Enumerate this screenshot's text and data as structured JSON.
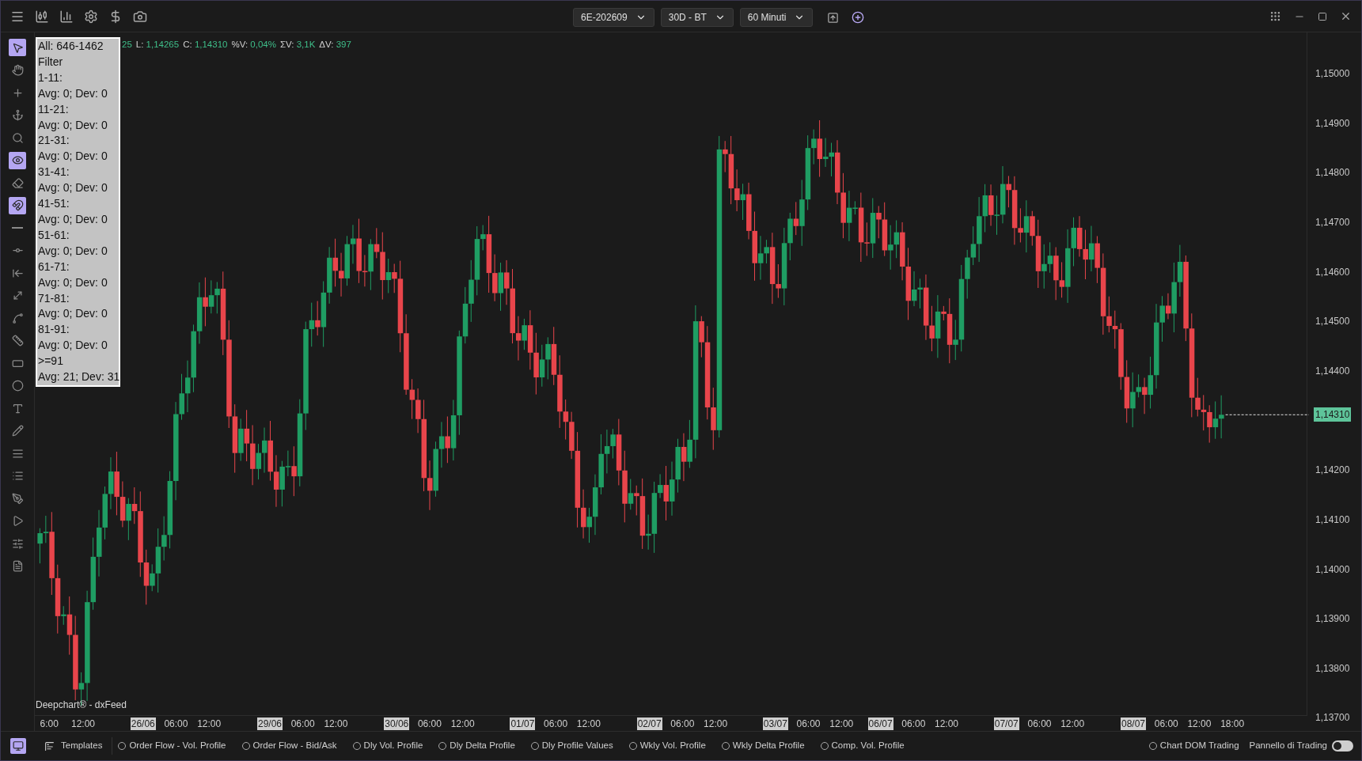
{
  "toolbar": {
    "dropdowns": [
      {
        "label": "6E-202609"
      },
      {
        "label": "30D - BT"
      },
      {
        "label": "60 Minuti"
      }
    ]
  },
  "tools": [
    {
      "selected": true
    },
    {
      "selected": false
    },
    {
      "selected": false
    },
    {
      "selected": false
    },
    {
      "selected": false
    },
    {
      "selected": true
    },
    {
      "selected": false
    },
    {
      "selected": true
    },
    {
      "selected": false
    },
    {
      "selected": false
    },
    {
      "selected": false
    },
    {
      "selected": false
    },
    {
      "selected": false
    },
    {
      "selected": false
    },
    {
      "selected": false
    },
    {
      "selected": false
    },
    {
      "selected": false
    },
    {
      "selected": false
    },
    {
      "selected": false
    },
    {
      "selected": false
    },
    {
      "selected": false
    },
    {
      "selected": false
    },
    {
      "selected": false
    },
    {
      "selected": false
    }
  ],
  "stats_box": {
    "lines": [
      "All: 646-1462",
      "Filter",
      "1-11:",
      "Avg: 0; Dev: 0",
      "11-21:",
      "Avg: 0; Dev: 0",
      "21-31:",
      "Avg: 0; Dev: 0",
      "31-41:",
      "Avg: 0; Dev: 0",
      "41-51:",
      "Avg: 0; Dev: 0",
      "51-61:",
      "Avg: 0; Dev: 0",
      "61-71:",
      "Avg: 0; Dev: 0",
      "71-81:",
      "Avg: 0; Dev: 0",
      "81-91:",
      "Avg: 0; Dev: 0",
      ">=91",
      "Avg: 21; Dev: 31"
    ]
  },
  "ohlc": [
    {
      "value": "25"
    },
    {
      "label": "L:",
      "value": "1,14265"
    },
    {
      "label": "C:",
      "value": "1,14310"
    },
    {
      "label": "%V:",
      "value": "0,04%"
    },
    {
      "label": "ΣV:",
      "value": "3,1K"
    },
    {
      "label": "ΔV:",
      "value": "397"
    }
  ],
  "watermark_label": "Deepchart® - dxFeed",
  "price_axis": [
    "1,15000",
    "1,14900",
    "1,14800",
    "1,14700",
    "1,14600",
    "1,14500",
    "1,14400",
    "1,14200",
    "1,14100",
    "1,14000",
    "1,13900",
    "1,13800",
    "1,13700"
  ],
  "current_price": "1,14310",
  "time_axis": [
    {
      "label": "6:00",
      "kind": "time"
    },
    {
      "label": "12:00",
      "kind": "time"
    },
    {
      "label": "26/06",
      "kind": "date"
    },
    {
      "label": "06:00",
      "kind": "time"
    },
    {
      "label": "12:00",
      "kind": "time"
    },
    {
      "label": "29/06",
      "kind": "date"
    },
    {
      "label": "06:00",
      "kind": "time"
    },
    {
      "label": "12:00",
      "kind": "time"
    },
    {
      "label": "30/06",
      "kind": "date"
    },
    {
      "label": "06:00",
      "kind": "time"
    },
    {
      "label": "12:00",
      "kind": "time"
    },
    {
      "label": "01/07",
      "kind": "date"
    },
    {
      "label": "06:00",
      "kind": "time"
    },
    {
      "label": "12:00",
      "kind": "time"
    },
    {
      "label": "02/07",
      "kind": "date"
    },
    {
      "label": "06:00",
      "kind": "time"
    },
    {
      "label": "12:00",
      "kind": "time"
    },
    {
      "label": "03/07",
      "kind": "date"
    },
    {
      "label": "06:00",
      "kind": "time"
    },
    {
      "label": "12:00",
      "kind": "time"
    },
    {
      "label": "06/07",
      "kind": "date"
    },
    {
      "label": "06:00",
      "kind": "time"
    },
    {
      "label": "12:00",
      "kind": "time"
    },
    {
      "label": "07/07",
      "kind": "date"
    },
    {
      "label": "06:00",
      "kind": "time"
    },
    {
      "label": "12:00",
      "kind": "time"
    },
    {
      "label": "08/07",
      "kind": "date"
    },
    {
      "label": "06:00",
      "kind": "time"
    },
    {
      "label": "12:00",
      "kind": "time"
    },
    {
      "label": "18:00",
      "kind": "time"
    }
  ],
  "bottom_bar": {
    "panel_button": {
      "selected": true
    },
    "templates": "Templates",
    "studies": [
      {
        "label": "Order Flow - Vol. Profile",
        "selected": false
      },
      {
        "label": "Order Flow - Bid/Ask",
        "selected": false
      },
      {
        "label": "Dly Vol. Profile",
        "selected": false
      },
      {
        "label": "Dly Delta Profile",
        "selected": false
      },
      {
        "label": "Dly Profile Values",
        "selected": false
      },
      {
        "label": "Wkly Vol. Profile",
        "selected": false
      },
      {
        "label": "Wkly Delta Profile",
        "selected": false
      },
      {
        "label": "Comp. Vol. Profile",
        "selected": false
      }
    ],
    "dom_trading": {
      "label": "Chart DOM Trading",
      "selected": false
    },
    "trading_panel": {
      "label": "Pannello di Trading",
      "on": false
    }
  }
}
